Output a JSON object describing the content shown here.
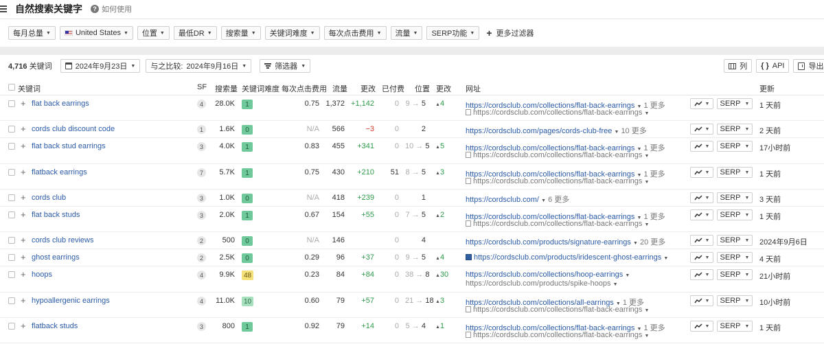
{
  "header": {
    "title": "自然搜索关键字",
    "help_label": "如何使用"
  },
  "filters": {
    "items": [
      "每月总量",
      "United States",
      "位置",
      "最低DR",
      "搜索量",
      "关键词难度",
      "每次点击费用",
      "流量",
      "SERP功能"
    ],
    "more_filters": "更多过滤器"
  },
  "toolbar": {
    "count": "4,716",
    "count_label": "关键词",
    "date": "2024年9月23日",
    "compare_label": "与之比较:",
    "compare_date": "2024年9月16日",
    "filter_label": "筛选器",
    "columns_label": "列",
    "api_label": "API",
    "export_label": "导出"
  },
  "table": {
    "headers": {
      "keyword": "关键词",
      "sf": "SF",
      "volume": "搜索量",
      "kd": "关键词难度",
      "cpc": "每次点击费用",
      "traffic": "流量",
      "change": "更改",
      "paid": "已付费",
      "position": "位置",
      "pos_change": "更改",
      "url": "网址",
      "updated": "更新"
    },
    "serp_label": "SERP",
    "rows": [
      {
        "keyword": "flat back earrings",
        "sf": "4",
        "volume": "28.0K",
        "kd": "1",
        "kd_color": "g",
        "cpc": "0.75",
        "traffic": "1,372",
        "change": "+1,142",
        "paid": "0",
        "pos_from": "9",
        "pos_to": "5",
        "pos_change": "4",
        "url": "https://cordsclub.com/collections/flat-back-earrings",
        "url_more": "1 更多",
        "url2": "https://cordsclub.com/collections/flat-back-earrings",
        "updated": "1 天前"
      },
      {
        "keyword": "cords club discount code",
        "sf": "1",
        "volume": "1.6K",
        "kd": "0",
        "kd_color": "g",
        "cpc": "N/A",
        "traffic": "566",
        "change": "−3",
        "paid": "0",
        "pos_from": "",
        "pos_to": "2",
        "pos_change": "",
        "url": "https://cordsclub.com/pages/cords-club-free",
        "url_more": "10 更多",
        "url2": "",
        "updated": "2 天前"
      },
      {
        "keyword": "flat back stud earrings",
        "sf": "3",
        "volume": "4.0K",
        "kd": "1",
        "kd_color": "g",
        "cpc": "0.83",
        "traffic": "455",
        "change": "+341",
        "paid": "0",
        "pos_from": "10",
        "pos_to": "5",
        "pos_change": "5",
        "url": "https://cordsclub.com/collections/flat-back-earrings",
        "url_more": "1 更多",
        "url2": "https://cordsclub.com/collections/flat-back-earrings",
        "updated": "17小时前"
      },
      {
        "keyword": "flatback earrings",
        "sf": "7",
        "volume": "5.7K",
        "kd": "1",
        "kd_color": "g",
        "cpc": "0.75",
        "traffic": "430",
        "change": "+210",
        "paid": "51",
        "pos_from": "8",
        "pos_to": "5",
        "pos_change": "3",
        "url": "https://cordsclub.com/collections/flat-back-earrings",
        "url_more": "1 更多",
        "url2": "https://cordsclub.com/collections/flat-back-earrings",
        "updated": "1 天前"
      },
      {
        "keyword": "cords club",
        "sf": "3",
        "volume": "1.0K",
        "kd": "0",
        "kd_color": "g",
        "cpc": "N/A",
        "traffic": "418",
        "change": "+239",
        "paid": "0",
        "pos_from": "",
        "pos_to": "1",
        "pos_change": "",
        "url": "https://cordsclub.com/",
        "url_more": "6 更多",
        "url2": "",
        "updated": "3 天前"
      },
      {
        "keyword": "flat back studs",
        "sf": "3",
        "volume": "2.0K",
        "kd": "1",
        "kd_color": "g",
        "cpc": "0.67",
        "traffic": "154",
        "change": "+55",
        "paid": "0",
        "pos_from": "7",
        "pos_to": "5",
        "pos_change": "2",
        "url": "https://cordsclub.com/collections/flat-back-earrings",
        "url_more": "1 更多",
        "url2": "https://cordsclub.com/collections/flat-back-earrings",
        "updated": "1 天前"
      },
      {
        "keyword": "cords club reviews",
        "sf": "2",
        "volume": "500",
        "kd": "0",
        "kd_color": "g",
        "cpc": "N/A",
        "traffic": "146",
        "change": "",
        "paid": "0",
        "pos_from": "",
        "pos_to": "4",
        "pos_change": "",
        "url": "https://cordsclub.com/products/signature-earrings",
        "url_more": "20 更多",
        "url2": "",
        "updated": "2024年9月6日"
      },
      {
        "keyword": "ghost earrings",
        "sf": "2",
        "volume": "2.5K",
        "kd": "0",
        "kd_color": "g",
        "cpc": "0.29",
        "traffic": "96",
        "change": "+37",
        "paid": "0",
        "pos_from": "9",
        "pos_to": "5",
        "pos_change": "4",
        "url": "https://cordsclub.com/products/iridescent-ghost-earrings",
        "url_more": "",
        "url2": "",
        "updated": "4 天前"
      },
      {
        "keyword": "hoops",
        "sf": "4",
        "volume": "9.9K",
        "kd": "48",
        "kd_color": "y",
        "cpc": "0.23",
        "traffic": "84",
        "change": "+84",
        "paid": "0",
        "pos_from": "38",
        "pos_to": "8",
        "pos_change": "30",
        "url": "https://cordsclub.com/collections/hoop-earrings",
        "url_more": "",
        "url2": "https://cordsclub.com/products/spike-hoops",
        "updated": "21小时前"
      },
      {
        "keyword": "hypoallergenic earrings",
        "sf": "4",
        "volume": "11.0K",
        "kd": "10",
        "kd_color": "lg",
        "cpc": "0.60",
        "traffic": "79",
        "change": "+57",
        "paid": "0",
        "pos_from": "21",
        "pos_to": "18",
        "pos_change": "3",
        "url": "https://cordsclub.com/collections/all-earrings",
        "url_more": "1 更多",
        "url2": "https://cordsclub.com/collections/flat-back-earrings",
        "updated": "10小时前"
      },
      {
        "keyword": "flatback studs",
        "sf": "3",
        "volume": "800",
        "kd": "1",
        "kd_color": "g",
        "cpc": "0.92",
        "traffic": "79",
        "change": "+14",
        "paid": "0",
        "pos_from": "5",
        "pos_to": "4",
        "pos_change": "1",
        "url": "https://cordsclub.com/collections/flat-back-earrings",
        "url_more": "1 更多",
        "url2": "https://cordsclub.com/collections/flat-back-earrings",
        "updated": "1 天前"
      }
    ]
  }
}
